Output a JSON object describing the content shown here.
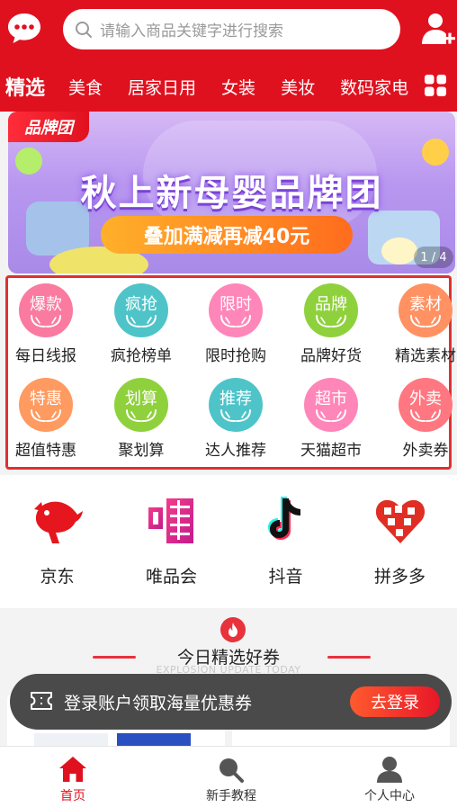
{
  "header": {
    "search_placeholder": "请输入商品关键字进行搜索",
    "tabs": [
      "精选",
      "美食",
      "居家日用",
      "女装",
      "美妆",
      "数码家电"
    ]
  },
  "banner": {
    "tag": "品牌团",
    "title": "秋上新母婴品牌团",
    "subtitle": "叠加满减再减40元",
    "page_indicator": "1 / 4"
  },
  "quick_entries": [
    {
      "badge": "爆款",
      "label": "每日线报",
      "color": "#fa7aa0"
    },
    {
      "badge": "疯抢",
      "label": "疯抢榜单",
      "color": "#4ec4c9"
    },
    {
      "badge": "限时",
      "label": "限时抢购",
      "color": "#ff86b8"
    },
    {
      "badge": "品牌",
      "label": "品牌好货",
      "color": "#8fd13c"
    },
    {
      "badge": "素材",
      "label": "精选素材",
      "color": "#ff9162"
    },
    {
      "badge": "特惠",
      "label": "超值特惠",
      "color": "#ff9a60"
    },
    {
      "badge": "划算",
      "label": "聚划算",
      "color": "#8fd13c"
    },
    {
      "badge": "推荐",
      "label": "达人推荐",
      "color": "#4ec4c9"
    },
    {
      "badge": "超市",
      "label": "天猫超市",
      "color": "#ff86b8"
    },
    {
      "badge": "外卖",
      "label": "外卖券",
      "color": "#ff7780"
    }
  ],
  "apps": [
    {
      "label": "京东",
      "icon": "jd-dog-icon"
    },
    {
      "label": "唯品会",
      "icon": "vip-icon"
    },
    {
      "label": "抖音",
      "icon": "tiktok-icon"
    },
    {
      "label": "拼多多",
      "icon": "pinduoduo-icon"
    }
  ],
  "deals": {
    "title": "今日精选好券",
    "subtitle": "EXPLOSION UPDATE TODAY"
  },
  "login_bar": {
    "text": "登录账户领取海量优惠券",
    "button": "去登录"
  },
  "bottom_nav": [
    {
      "label": "首页",
      "icon": "home-icon",
      "active": true
    },
    {
      "label": "新手教程",
      "icon": "search-icon",
      "active": false
    },
    {
      "label": "个人中心",
      "icon": "user-icon",
      "active": false
    }
  ],
  "colors": {
    "brand": "#e0111f",
    "accent": "#ff5a2e"
  }
}
